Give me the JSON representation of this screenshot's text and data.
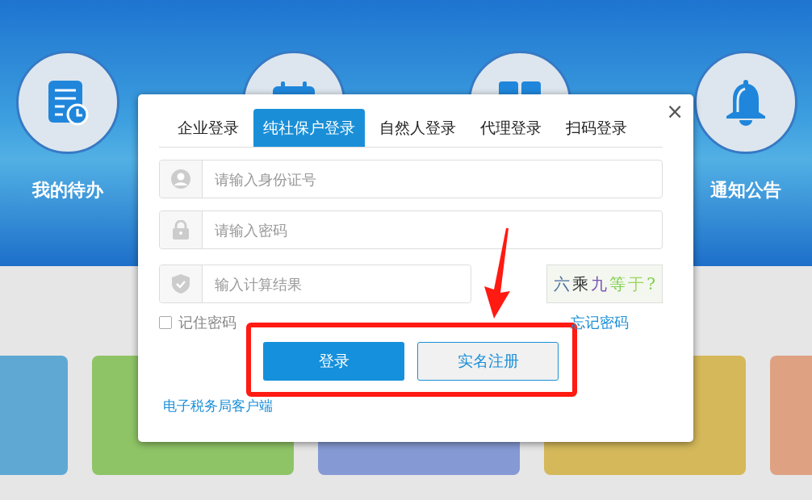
{
  "shortcuts": [
    {
      "kind": "todo",
      "label": "我的待办"
    },
    {
      "kind": "calendar"
    },
    {
      "kind": "grid"
    },
    {
      "kind": "bell",
      "label": "通知公告"
    }
  ],
  "tiles": [
    {
      "color": "#5fa8d3"
    },
    {
      "color": "#8fc466"
    },
    {
      "color": "#8599d4"
    },
    {
      "color": "#d4b85a"
    },
    {
      "color": "#dea283"
    }
  ],
  "dialog": {
    "close": "×",
    "tabs": [
      {
        "label": "企业登录",
        "selected": false
      },
      {
        "label": "纯社保户登录",
        "selected": true
      },
      {
        "label": "自然人登录",
        "selected": false
      },
      {
        "label": "代理登录",
        "selected": false
      },
      {
        "label": "扫码登录",
        "selected": false
      }
    ],
    "fields": [
      {
        "kind": "user",
        "placeholder": "请输入身份证号"
      },
      {
        "kind": "lock",
        "placeholder": "请输入密码"
      },
      {
        "kind": "shield",
        "placeholder": "输入计算结果"
      }
    ],
    "captcha": "六乘九等于?",
    "remember": {
      "label": "记住密码",
      "checked": false
    },
    "forgot_link": "忘记密码",
    "buttons": [
      {
        "label": "登录",
        "kind": "primary"
      },
      {
        "label": "实名注册",
        "kind": "secondary"
      }
    ],
    "client_link": "电子税务局客户端"
  }
}
